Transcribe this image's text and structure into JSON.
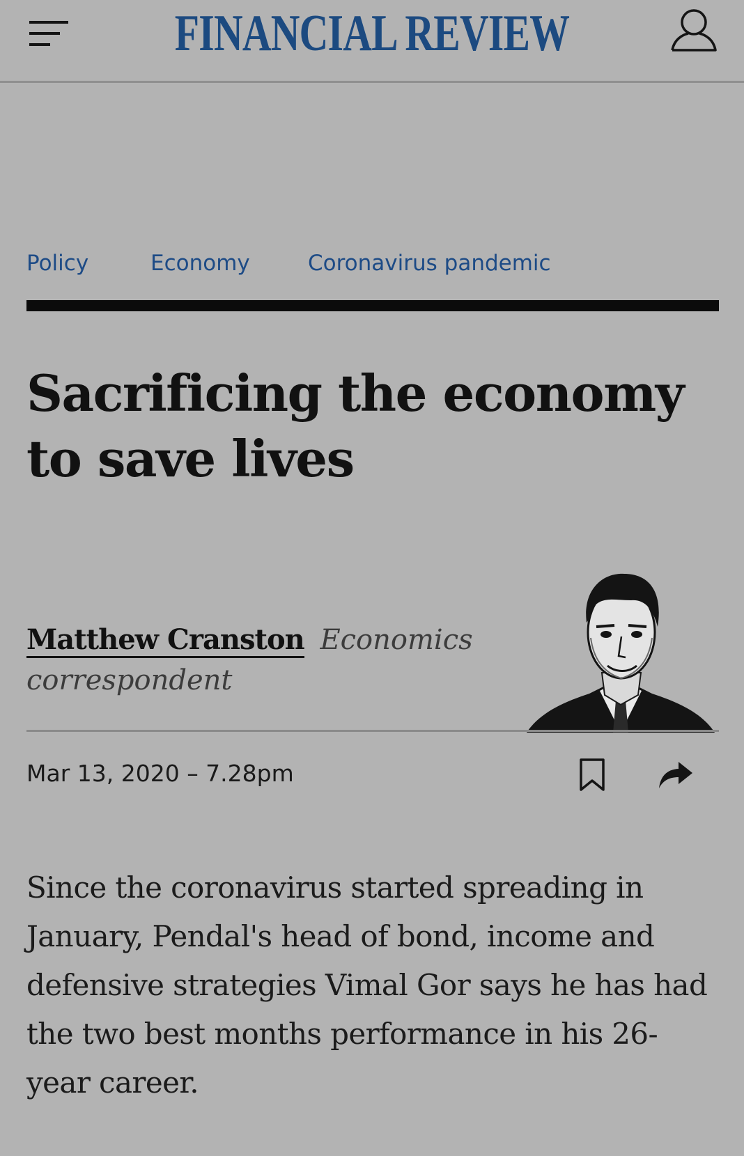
{
  "header": {
    "masthead": "FINANCIAL REVIEW",
    "menu_icon": "hamburger-menu-icon",
    "account_icon": "user-account-icon"
  },
  "tags": [
    "Policy",
    "Economy",
    "Coronavirus pandemic"
  ],
  "article": {
    "headline": "Sacrificing the economy to save lives",
    "author": "Matthew Cranston",
    "author_role": "Economics correspondent",
    "dateline": "Mar 13, 2020 – 7.28pm",
    "body": "Since the coronavirus started spreading in January, Pendal's head of bond, income and defensive strategies Vimal Gor says he has had the two best months performance in his 26-year career."
  },
  "actions": {
    "bookmark_icon": "bookmark-icon",
    "share_icon": "share-arrow-icon"
  },
  "colors": {
    "background": "#b3b3b3",
    "brand_blue": "#1c4a80",
    "tag_blue": "#1d4b86",
    "text": "#141414"
  }
}
